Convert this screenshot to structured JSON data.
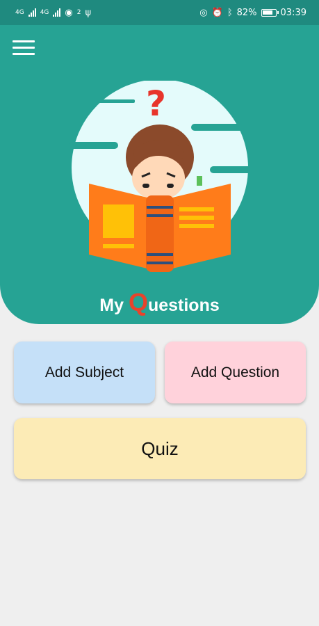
{
  "status_bar": {
    "network_1": "4G",
    "network_2": "4G",
    "hotspot_count": "2",
    "battery": "82%",
    "time": "03:39"
  },
  "header": {
    "title_prefix": "My ",
    "title_highlight": "Q",
    "title_suffix": "uestions",
    "accent": "#26a394",
    "highlight_color": "#e8432b"
  },
  "actions": {
    "add_subject": "Add Subject",
    "add_question": "Add Question",
    "quiz": "Quiz"
  }
}
